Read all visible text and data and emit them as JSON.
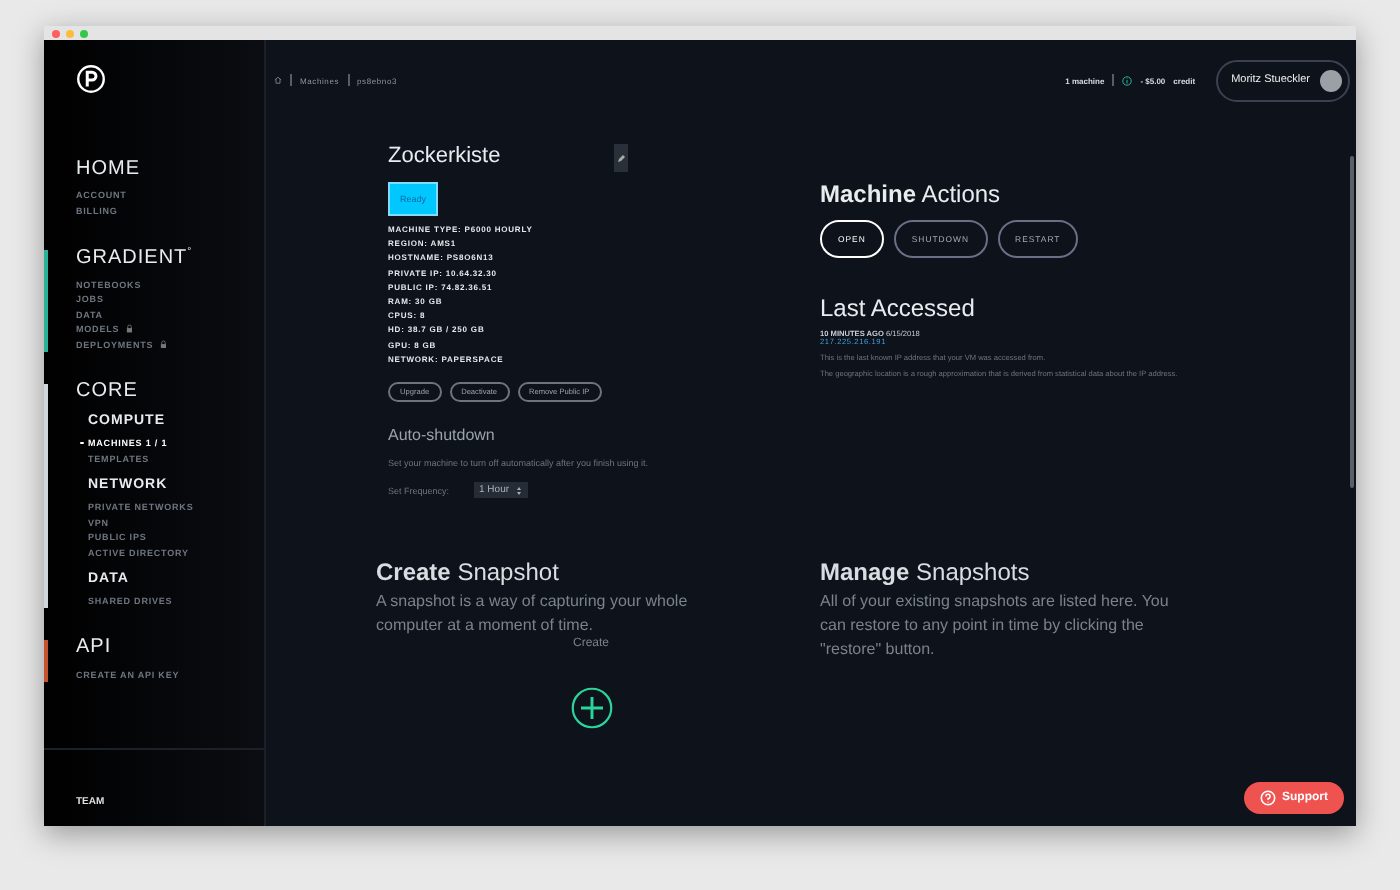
{
  "sidebar": {
    "sections": [
      {
        "title": "HOME",
        "items": [
          {
            "label": "ACCOUNT",
            "selected": false,
            "locked": false
          },
          {
            "label": "BILLING",
            "selected": false,
            "locked": false
          }
        ]
      },
      {
        "title": "GRADIENT",
        "sup": "°",
        "color": "#2bb39a",
        "items": [
          {
            "label": "NOTEBOOKS",
            "selected": false,
            "locked": false
          },
          {
            "label": "JOBS",
            "selected": false,
            "locked": false
          },
          {
            "label": "DATA",
            "selected": false,
            "locked": false
          },
          {
            "label": "MODELS",
            "selected": false,
            "locked": true
          },
          {
            "label": "DEPLOYMENTS",
            "selected": false,
            "locked": true
          }
        ]
      },
      {
        "title": "CORE",
        "color": "#cfd6dc",
        "groups": [
          {
            "title": "COMPUTE",
            "items": [
              {
                "label": "MACHINES 1 / 1",
                "selected": true,
                "locked": false
              },
              {
                "label": "TEMPLATES",
                "selected": false,
                "locked": false
              }
            ]
          },
          {
            "title": "NETWORK",
            "items": [
              {
                "label": "PRIVATE NETWORKS",
                "selected": false,
                "locked": false
              },
              {
                "label": "VPN",
                "selected": false,
                "locked": false
              },
              {
                "label": "PUBLIC IPS",
                "selected": false,
                "locked": false
              },
              {
                "label": "ACTIVE DIRECTORY",
                "selected": false,
                "locked": false
              }
            ]
          },
          {
            "title": "DATA",
            "items": [
              {
                "label": "SHARED DRIVES",
                "selected": false,
                "locked": false
              }
            ]
          }
        ]
      },
      {
        "title": "API",
        "color": "#c4532e",
        "items": [
          {
            "label": "CREATE AN API KEY",
            "selected": false,
            "locked": false
          }
        ]
      }
    ],
    "footer": "TEAM"
  },
  "breadcrumbs": [
    "Machines",
    "ps8ebno3"
  ],
  "account": {
    "machines": "1 machine",
    "credit_amount": "- $5.00",
    "credit_label": "credit",
    "user": "Moritz Stueckler"
  },
  "machine": {
    "name": "Zockerkiste",
    "status": "Ready",
    "specs": [
      "MACHINE TYPE: P6000 HOURLY",
      "REGION: AMS1",
      "HOSTNAME: PS8O6N13",
      "PRIVATE IP: 10.64.32.30",
      "PUBLIC IP: 74.82.36.51",
      "RAM: 30 GB",
      "CPUS: 8",
      "HD: 38.7 GB / 250 GB",
      "GPU: 8 GB",
      "NETWORK: PAPERSPACE"
    ],
    "buttons": [
      "Upgrade",
      "Deactivate",
      "Remove Public IP"
    ]
  },
  "auto_shutdown": {
    "title": "Auto-shutdown",
    "description": "Set your machine to turn off automatically after you finish using it.",
    "frequency_label": "Set Frequency:",
    "frequency": "1 Hour"
  },
  "machine_actions": {
    "title": "**Machine** Actions",
    "buttons": [
      {
        "label": "OPEN",
        "emphasized": true
      },
      {
        "label": "SHUTDOWN",
        "emphasized": false
      },
      {
        "label": "RESTART",
        "emphasized": false
      }
    ]
  },
  "last_accessed": {
    "title": "Last Accessed",
    "when": "**10 MINUTES AGO** 6/15/2018",
    "ip": "217.225.216.191",
    "notes": [
      "This is the last known IP address that your VM was accessed from.",
      "The geographic location is a rough approximation that is derived from statistical data about the IP address."
    ]
  },
  "create_snapshot": {
    "title": "**Create** Snapshot",
    "description": "A snapshot is a way of capturing your whole computer at a moment of time.",
    "action_label": "Create"
  },
  "manage_snapshots": {
    "title": "**Manage** Snapshots",
    "description": "All of your existing snapshots are listed here. You can restore to any point in time by clicking the \"restore\" button."
  },
  "support_button": "Support"
}
